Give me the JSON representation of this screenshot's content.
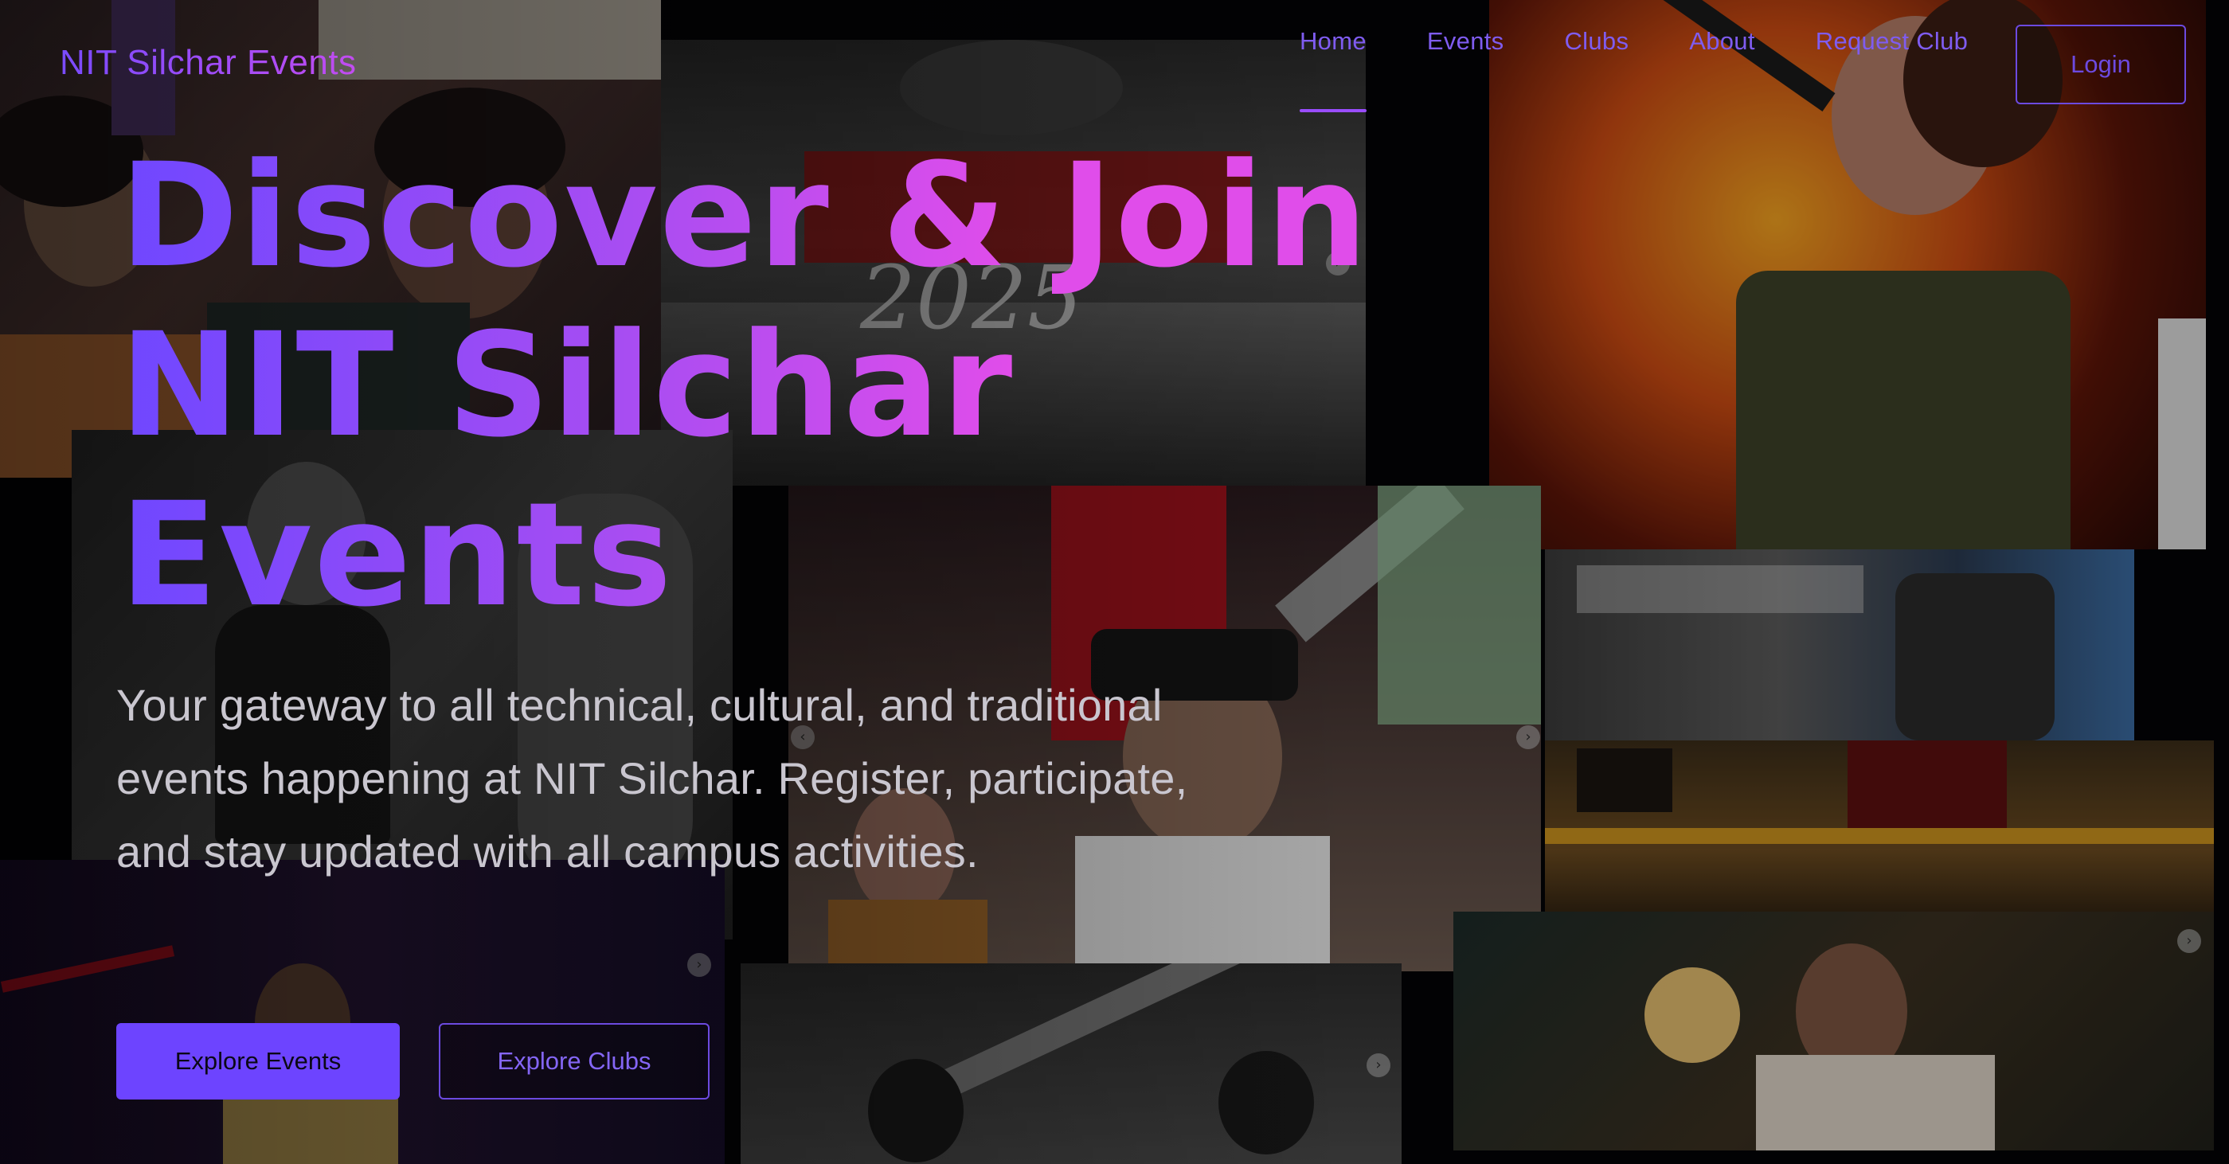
{
  "brand": {
    "name": "NIT Silchar Events"
  },
  "nav": {
    "items": [
      {
        "label": "Home",
        "active": true
      },
      {
        "label": "Events",
        "active": false
      },
      {
        "label": "Clubs",
        "active": false
      },
      {
        "label": "About",
        "active": false
      },
      {
        "label": "Request Club",
        "active": false
      }
    ],
    "login_label": "Login"
  },
  "hero": {
    "headline_lines": [
      "Discover & Join",
      "NIT Silchar",
      "Events"
    ],
    "subtitle": "Your gateway to all technical, cultural, and traditional events happening at NIT Silchar. Register, participate, and stay updated with all campus activities.",
    "primary_cta": "Explore Events",
    "secondary_cta": "Explore Clubs"
  },
  "background": {
    "poster_text": "2025",
    "carousel_arrow_icon": "chevron-right-icon"
  },
  "colors": {
    "accent": "#6d44ff",
    "gradient_start": "#6f47ff",
    "gradient_end": "#e04dea",
    "subtitle_text": "#c9c6cf",
    "background": "#040306"
  }
}
